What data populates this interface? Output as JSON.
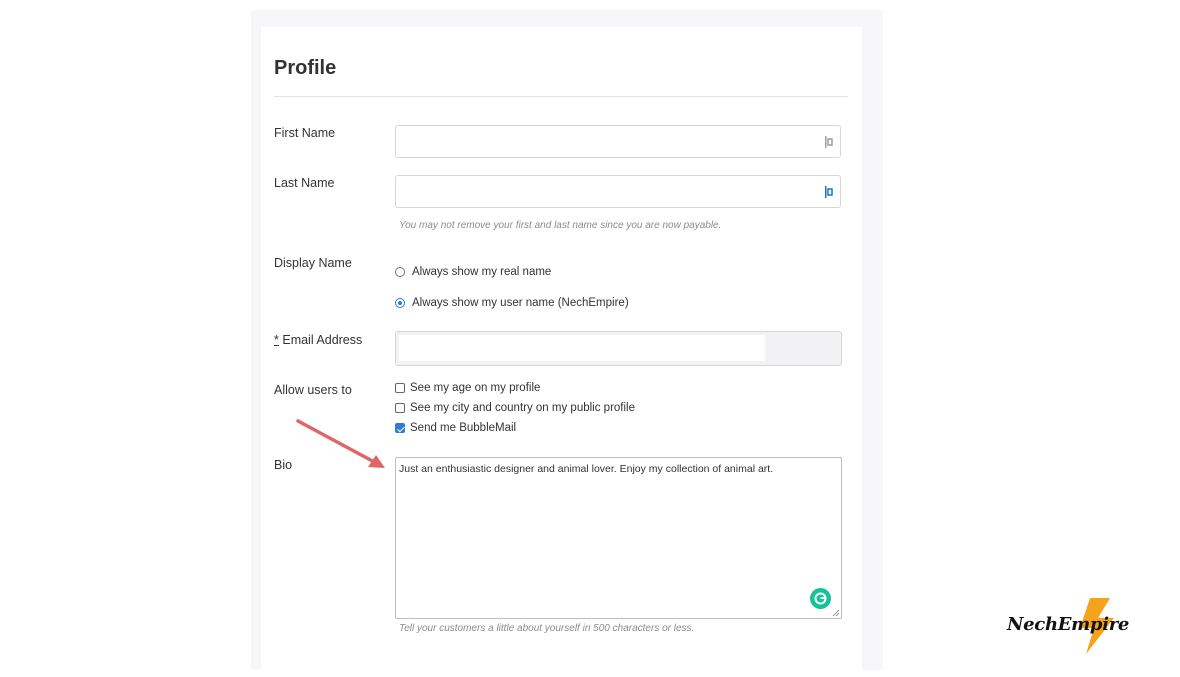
{
  "form": {
    "title": "Profile",
    "first_name_label": "First Name",
    "last_name_label": "Last Name",
    "name_hint": "You may not remove your first and last name since you are now payable.",
    "display_name_label": "Display Name",
    "display_options": [
      {
        "label": "Always show my real name",
        "selected": false
      },
      {
        "label": "Always show my user name (NechEmpire)",
        "selected": true
      }
    ],
    "email_required_marker": "*",
    "email_label": "Email Address",
    "allow_label": "Allow users to",
    "allow_options": [
      {
        "label": "See my age on my profile",
        "checked": false
      },
      {
        "label": "See my city and country on my public profile",
        "checked": false
      },
      {
        "label": "Send me BubbleMail",
        "checked": true
      }
    ],
    "bio_label": "Bio",
    "bio_value": "Just an enthusiastic designer and animal lover. Enjoy my collection of animal art.",
    "bio_hint": "Tell your customers a little about yourself in 500 characters or less."
  },
  "icons": {
    "password_manager": "lastpass-icon",
    "grammarly": "grammarly-icon",
    "annotation_arrow": "arrow-icon"
  },
  "colors": {
    "accent": "#2f7bd9",
    "arrow": "#e06666",
    "logo_accent": "#f7a21b",
    "grammarly": "#15c39a"
  },
  "watermark": {
    "text": "NechEmpire"
  }
}
